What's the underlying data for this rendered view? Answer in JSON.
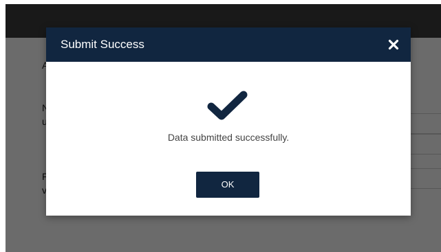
{
  "background": {
    "partial_labels": [
      "A",
      "N",
      "u",
      "F",
      "v"
    ]
  },
  "dialog": {
    "title": "Submit Success",
    "close_icon": "close-icon",
    "status_icon": "checkmark-icon",
    "message": "Data submitted successfully.",
    "ok_label": "OK"
  },
  "colors": {
    "header_navy": "#112640",
    "button_navy": "#112640",
    "message_text": "#444444"
  }
}
